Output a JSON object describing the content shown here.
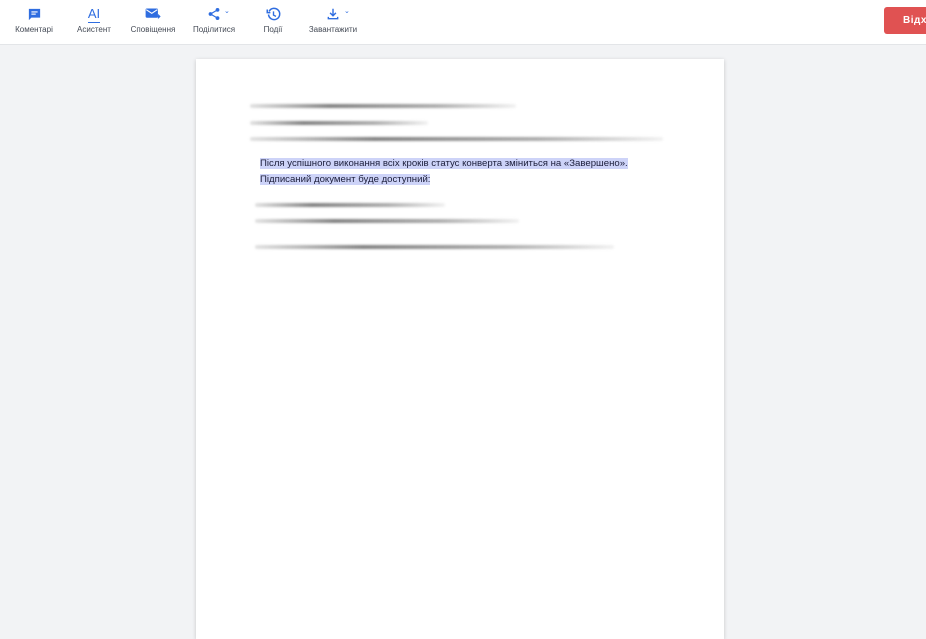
{
  "toolbar": {
    "items": [
      {
        "label": "Коментарі",
        "icon": "comment-icon"
      },
      {
        "label": "Асистент",
        "icon": "ai-assistant-icon"
      },
      {
        "label": "Сповіщення",
        "icon": "mail-send-icon"
      },
      {
        "label": "Поділитися",
        "icon": "share-icon"
      },
      {
        "label": "Події",
        "icon": "history-icon"
      },
      {
        "label": "Завантажити",
        "icon": "download-icon"
      }
    ],
    "ai_glyph": "AI",
    "decline_label": "Відхилити"
  },
  "document": {
    "paragraph_line1": "Після успішного виконання всіх кроків статус конверта зміниться на «Завершено».",
    "paragraph_line2": "Підписаний документ буде доступний:"
  },
  "colors": {
    "accent": "#2f6de0",
    "danger": "#e05252",
    "highlight": "#cdd3f8"
  }
}
